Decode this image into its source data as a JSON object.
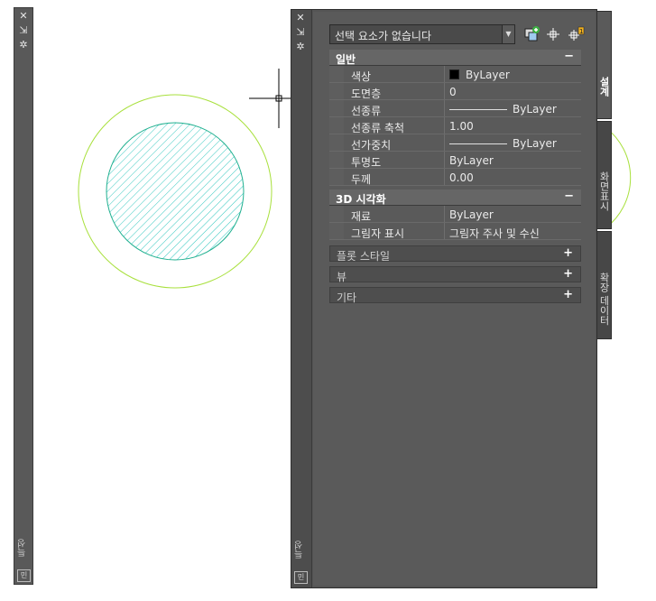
{
  "left_palette": {
    "close": "✕",
    "pin": "⇲",
    "settings": "✲",
    "label": "특성",
    "bottom_icon": "민"
  },
  "palette": {
    "close": "✕",
    "pin": "⇲",
    "settings": "✲",
    "label": "특성",
    "bottom_icon": "민",
    "selection": "선택 요소가 없습니다",
    "tools": [
      {
        "icon": "quick-select-icon"
      },
      {
        "icon": "select-objects-icon"
      },
      {
        "icon": "toggle-pickadd-icon"
      }
    ],
    "sections": {
      "general": {
        "title": "일반",
        "toggle": "−",
        "rows": [
          {
            "name": "색상",
            "value": "ByLayer"
          },
          {
            "name": "도면층",
            "value": "0"
          },
          {
            "name": "선종류",
            "value": "ByLayer"
          },
          {
            "name": "선종류 축척",
            "value": "1.00"
          },
          {
            "name": "선가중치",
            "value": "ByLayer"
          },
          {
            "name": "투명도",
            "value": "ByLayer"
          },
          {
            "name": "두께",
            "value": "0.00"
          }
        ]
      },
      "visualization": {
        "title": "3D 시각화",
        "toggle": "−",
        "rows": [
          {
            "name": "재료",
            "value": "ByLayer"
          },
          {
            "name": "그림자 표시",
            "value": "그림자 주사 및 수신"
          }
        ]
      },
      "plot_style": {
        "title": "플롯 스타일",
        "toggle": "+"
      },
      "view": {
        "title": "뷰",
        "toggle": "+"
      },
      "misc": {
        "title": "기타",
        "toggle": "+"
      }
    },
    "side_tabs": [
      {
        "label": "설계"
      },
      {
        "label": "화면표시"
      },
      {
        "label": "확장 데이터"
      }
    ]
  },
  "colors": {
    "outer_circle": "#a8e03c",
    "hatch": "#36c8c0",
    "palette_bg": "#5a5a5a"
  }
}
